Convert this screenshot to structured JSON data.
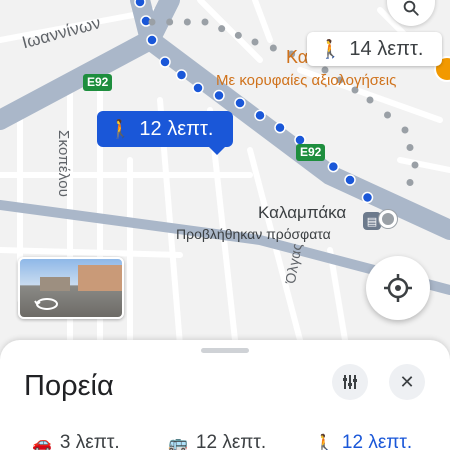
{
  "map": {
    "streets": {
      "ioannina": "Ιωαννίνων",
      "skopelou": "Σκοπέλου",
      "olga": "Όλγας"
    },
    "road_shields": [
      "E92",
      "E92"
    ],
    "route_badge": {
      "icon": "walk-icon",
      "label": "12 λεπτ."
    },
    "alternative_badge": {
      "icon": "walk-icon",
      "label": "14 λεπτ."
    },
    "poi": {
      "name_partial": "Κα",
      "subtitle": "Με κορυφαίες αξιολογήσεις",
      "color": "#d0721b"
    },
    "destination": {
      "name": "Καλαμπάκα",
      "subtitle": "Προβλήθηκαν πρόσφατα",
      "icon": "transit-stop-icon"
    },
    "route_color": "#1a57d8",
    "search_icon": "search-icon",
    "locate_icon": "my-location-icon",
    "streetview_icon": "rotate-360-icon"
  },
  "sheet": {
    "title": "Πορεία",
    "options_icon": "tune-icon",
    "close_icon": "close-icon",
    "modes": [
      {
        "icon": "car-icon",
        "label": "3 λεπτ.",
        "selected": false
      },
      {
        "icon": "transit-icon",
        "label": "12 λεπτ.",
        "selected": false
      },
      {
        "icon": "walk-icon",
        "label": "12 λεπτ.",
        "selected": true
      }
    ],
    "accent_color": "#1a57d8"
  }
}
